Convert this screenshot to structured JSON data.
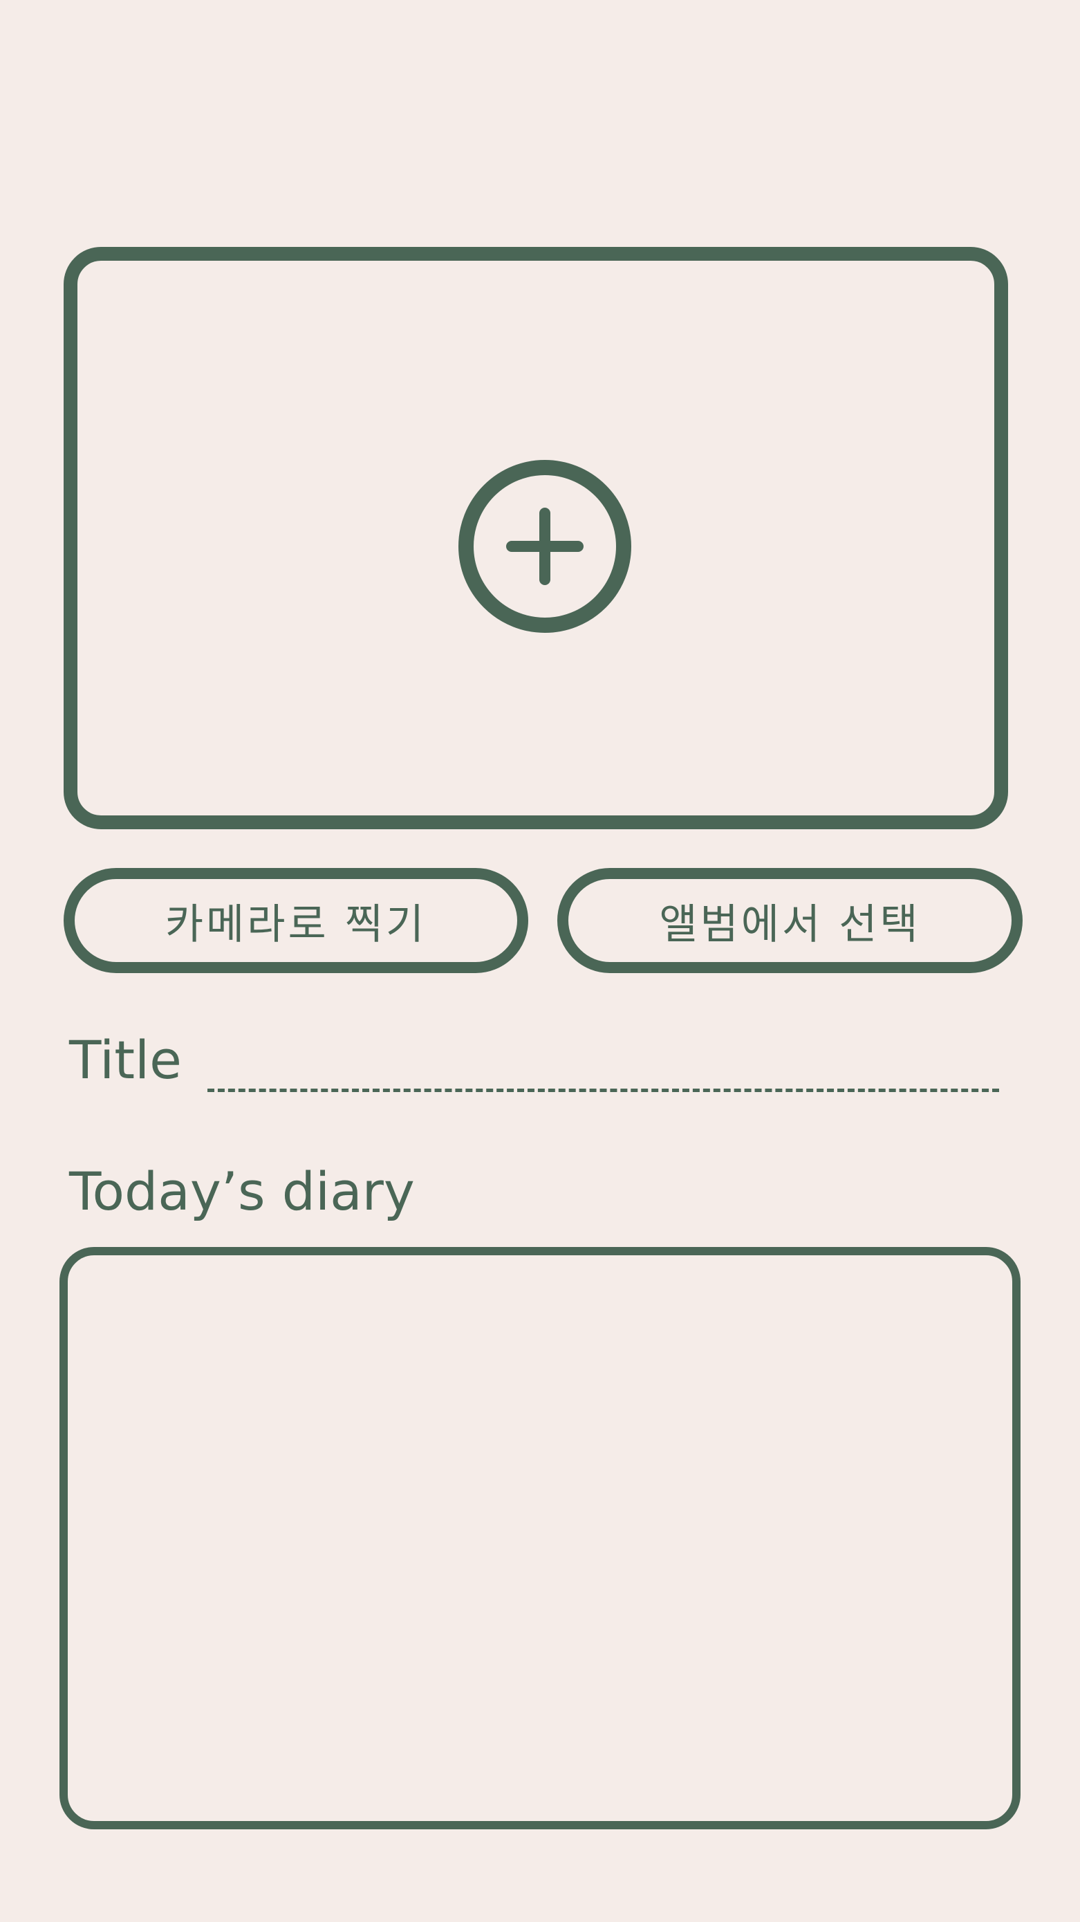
{
  "photo": {
    "add_icon": "circle-plus-icon"
  },
  "buttons": {
    "camera_label": "카메라로 찍기",
    "album_label": "앨범에서 선택"
  },
  "title": {
    "label": "Title",
    "value": ""
  },
  "diary": {
    "label": "Today’s diary",
    "value": ""
  },
  "colors": {
    "background": "#f5ece8",
    "accent": "#4a6656"
  }
}
